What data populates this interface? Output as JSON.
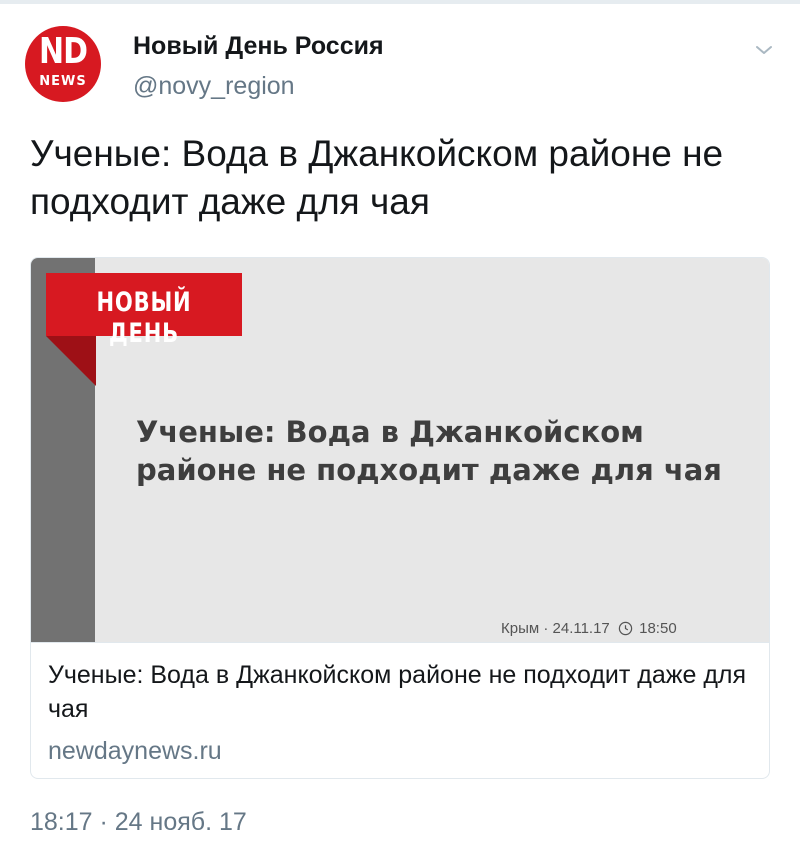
{
  "account": {
    "avatar_top": "ND",
    "avatar_bottom": "NEWS",
    "display_name": "Новый День Россия",
    "handle": "@novy_region"
  },
  "tweet": {
    "text": "Ученые: Вода в Джанкойском районе не подходит даже для чая",
    "timestamp": "18:17 · 24 нояб. 17"
  },
  "card": {
    "image": {
      "banner": "НОВЫЙ ДЕНЬ",
      "headline": "Ученые: Вода в Джанкойском районе не подходит даже для чая",
      "meta_prefix": "Крым · 24.11.17",
      "meta_time": "18:50"
    },
    "title": "Ученые: Вода в Джанкойском районе не подходит даже для чая",
    "domain": "newdaynews.ru"
  },
  "colors": {
    "brand_red": "#d71921",
    "secondary_text": "#657786",
    "image_sidebar": "#727272",
    "image_background": "#e7e7e7"
  },
  "icons": [
    "chevron-down-icon",
    "clock-icon"
  ]
}
